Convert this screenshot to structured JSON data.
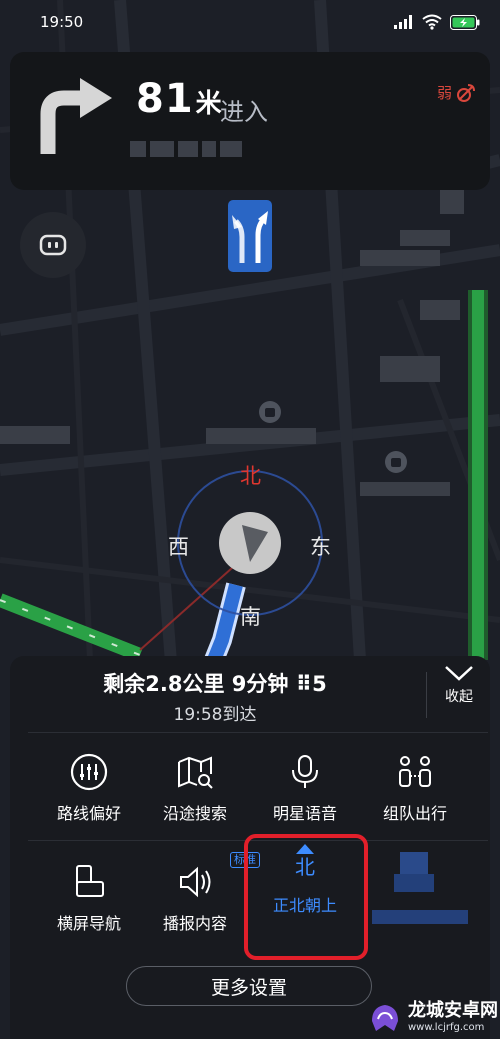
{
  "status_bar": {
    "time": "19:50"
  },
  "navigation": {
    "distance": "81",
    "distance_unit": "米",
    "action": "进入",
    "signal_text": "弱"
  },
  "compass": {
    "north": "北",
    "east": "东",
    "south": "南",
    "west": "西"
  },
  "route_summary": {
    "remaining": "剩余2.8公里 9分钟 ⠿5",
    "arrival": "19:58到达"
  },
  "collapse_label": "收起",
  "menu_row1": [
    {
      "label": "路线偏好",
      "icon": "route-preference-icon"
    },
    {
      "label": "沿途搜索",
      "icon": "map-search-icon"
    },
    {
      "label": "明星语音",
      "icon": "microphone-icon"
    },
    {
      "label": "组队出行",
      "icon": "team-travel-icon"
    }
  ],
  "menu_row2": [
    {
      "label": "横屏导航",
      "icon": "landscape-nav-icon"
    },
    {
      "label": "播报内容",
      "icon": "speaker-icon",
      "tag": "标准"
    },
    {
      "label": "正北朝上",
      "icon": "north-up-icon",
      "glyph": "北",
      "active": true
    }
  ],
  "more_settings": "更多设置",
  "watermark": {
    "title": "龙城安卓网",
    "url": "www.lcjrfg.com"
  },
  "colors": {
    "accent_blue": "#3d8cff",
    "highlight_red": "#e21f2a",
    "compass_north_red": "#e0372f",
    "panel_bg": "#181a1f",
    "route_blue": "#2f6fd6",
    "traffic_green": "#28a745"
  }
}
